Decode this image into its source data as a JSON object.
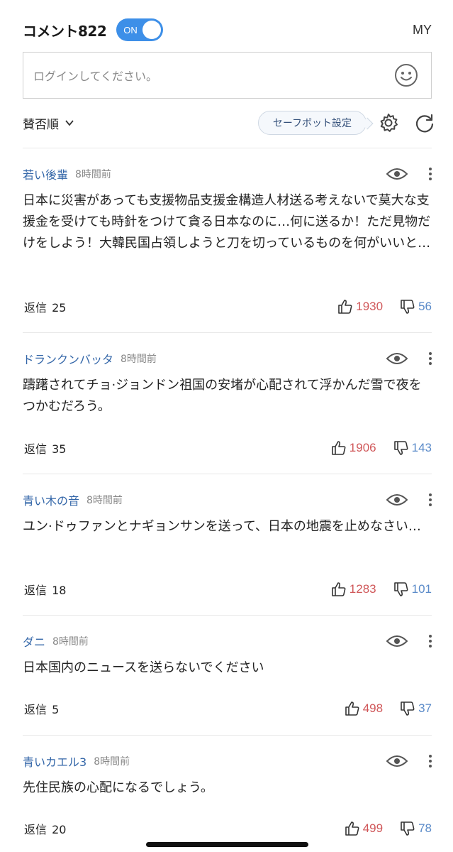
{
  "header": {
    "title": "コメント822",
    "toggle_label": "ON",
    "my_label": "MY"
  },
  "login": {
    "placeholder": "ログインしてください。"
  },
  "sortbar": {
    "sort_label": "賛否順",
    "safebot_label": "セーフボット設定"
  },
  "colors": {
    "toggle": "#3d8fe8",
    "author": "#3366a8",
    "like": "#d0585a",
    "dislike": "#5b8bc9"
  },
  "comments": [
    {
      "author": "若い後輩",
      "time": "8時間前",
      "body": "日本に災害があっても支援物品支援金構造人材送る考えないで莫大な支援金を受けても時針をつけて貪る日本なのに…何に送るか！ただ見物だけをしよう！大韓民国占領しようと刀を切っているものを何がいいと…",
      "reply_label": "返信",
      "replies": "25",
      "likes": "1930",
      "dislikes": "56"
    },
    {
      "author": "ドランクンバッタ",
      "time": "8時間前",
      "body": "躊躇されてチョ·ジョンドン祖国の安堵が心配されて浮かんだ雪で夜をつかむだろう。",
      "reply_label": "返信",
      "replies": "35",
      "likes": "1906",
      "dislikes": "143"
    },
    {
      "author": "青い木の音",
      "time": "8時間前",
      "body": "ユン·ドゥファンとナギョンサンを送って、日本の地震を止めなさい…",
      "reply_label": "返信",
      "replies": "18",
      "likes": "1283",
      "dislikes": "101"
    },
    {
      "author": "ダニ",
      "time": "8時間前",
      "body": "日本国内のニュースを送らないでください",
      "reply_label": "返信",
      "replies": "5",
      "likes": "498",
      "dislikes": "37"
    },
    {
      "author": "青いカエル3",
      "time": "8時間前",
      "body": "先住民族の心配になるでしょう。",
      "reply_label": "返信",
      "replies": "20",
      "likes": "499",
      "dislikes": "78"
    }
  ]
}
